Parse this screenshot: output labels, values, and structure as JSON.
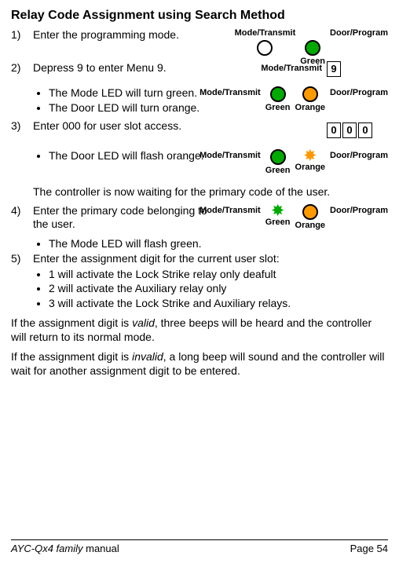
{
  "title": "Relay Code Assignment using Search Method",
  "labels": {
    "modeTransmit": "Mode/Transmit",
    "doorProgram": "Door/Program",
    "green": "Green",
    "orange": "Orange"
  },
  "steps": {
    "s1": {
      "num": "1)",
      "text": "Enter the programming mode."
    },
    "s2": {
      "num": "2)",
      "text": "Depress 9 to enter Menu 9.",
      "key": "9"
    },
    "s2_b1": "The Mode LED will turn green.",
    "s2_b2": "The Door LED will turn orange.",
    "s3": {
      "num": "3)",
      "text": "Enter 000 for user slot access.",
      "keys": [
        "0",
        "0",
        "0"
      ]
    },
    "s3_b1": "The Door LED will flash orange.",
    "note": "The controller is now waiting for the primary code of the user.",
    "s4": {
      "num": "4)",
      "text": "Enter the primary code belonging to the user."
    },
    "s4_b1": "The Mode LED will flash green.",
    "s5": {
      "num": "5)",
      "text": "Enter the assignment digit for the current user slot:"
    },
    "s5_b1": "1 will activate the Lock Strike relay only deafult",
    "s5_b2": "2 will activate the Auxiliary relay only",
    "s5_b3": "3 will activate the Lock Strike and Auxiliary relays."
  },
  "p_valid_a": "If the assignment digit is ",
  "p_valid_i": "valid",
  "p_valid_b": ", three beeps will be heard and the controller will return to its normal mode.",
  "p_invalid_a": "If the assignment digit is ",
  "p_invalid_i": "invalid",
  "p_invalid_b": ", a long beep will sound and the controller will wait for another assignment digit to be entered.",
  "footer": {
    "left_a": "AYC-Qx4 family",
    "left_b": " manual",
    "right": "Page 54"
  }
}
